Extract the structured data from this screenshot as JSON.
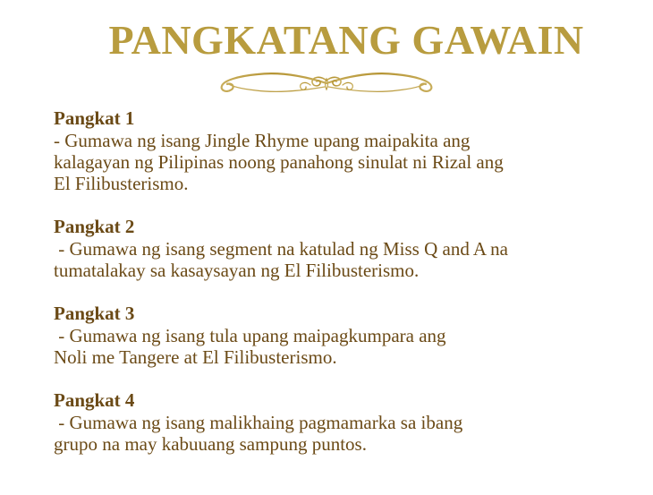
{
  "title": "PANGKATANG GAWAIN",
  "ornament_icon": "gold-flourish-divider-icon",
  "colors": {
    "title": "#b89c3f",
    "text": "#6b4a16"
  },
  "groups": [
    {
      "heading": "Pangkat 1",
      "lines": [
        "- Gumawa ng isang Jingle Rhyme upang maipakita ang",
        "kalagayan ng Pilipinas noong panahong sinulat ni Rizal ang",
        "El Filibusterismo."
      ]
    },
    {
      "heading": "Pangkat 2",
      "lines": [
        " - Gumawa ng isang segment na katulad ng Miss Q and A na",
        "tumatalakay sa kasaysayan ng El Filibusterismo."
      ]
    },
    {
      "heading": "Pangkat 3",
      "lines": [
        " - Gumawa ng isang tula upang maipagkumpara ang",
        "Noli me Tangere at El Filibusterismo."
      ]
    },
    {
      "heading": "Pangkat 4",
      "lines": [
        " - Gumawa ng isang malikhaing pagmamarka sa ibang",
        "grupo na may kabuuang sampung puntos."
      ]
    }
  ]
}
